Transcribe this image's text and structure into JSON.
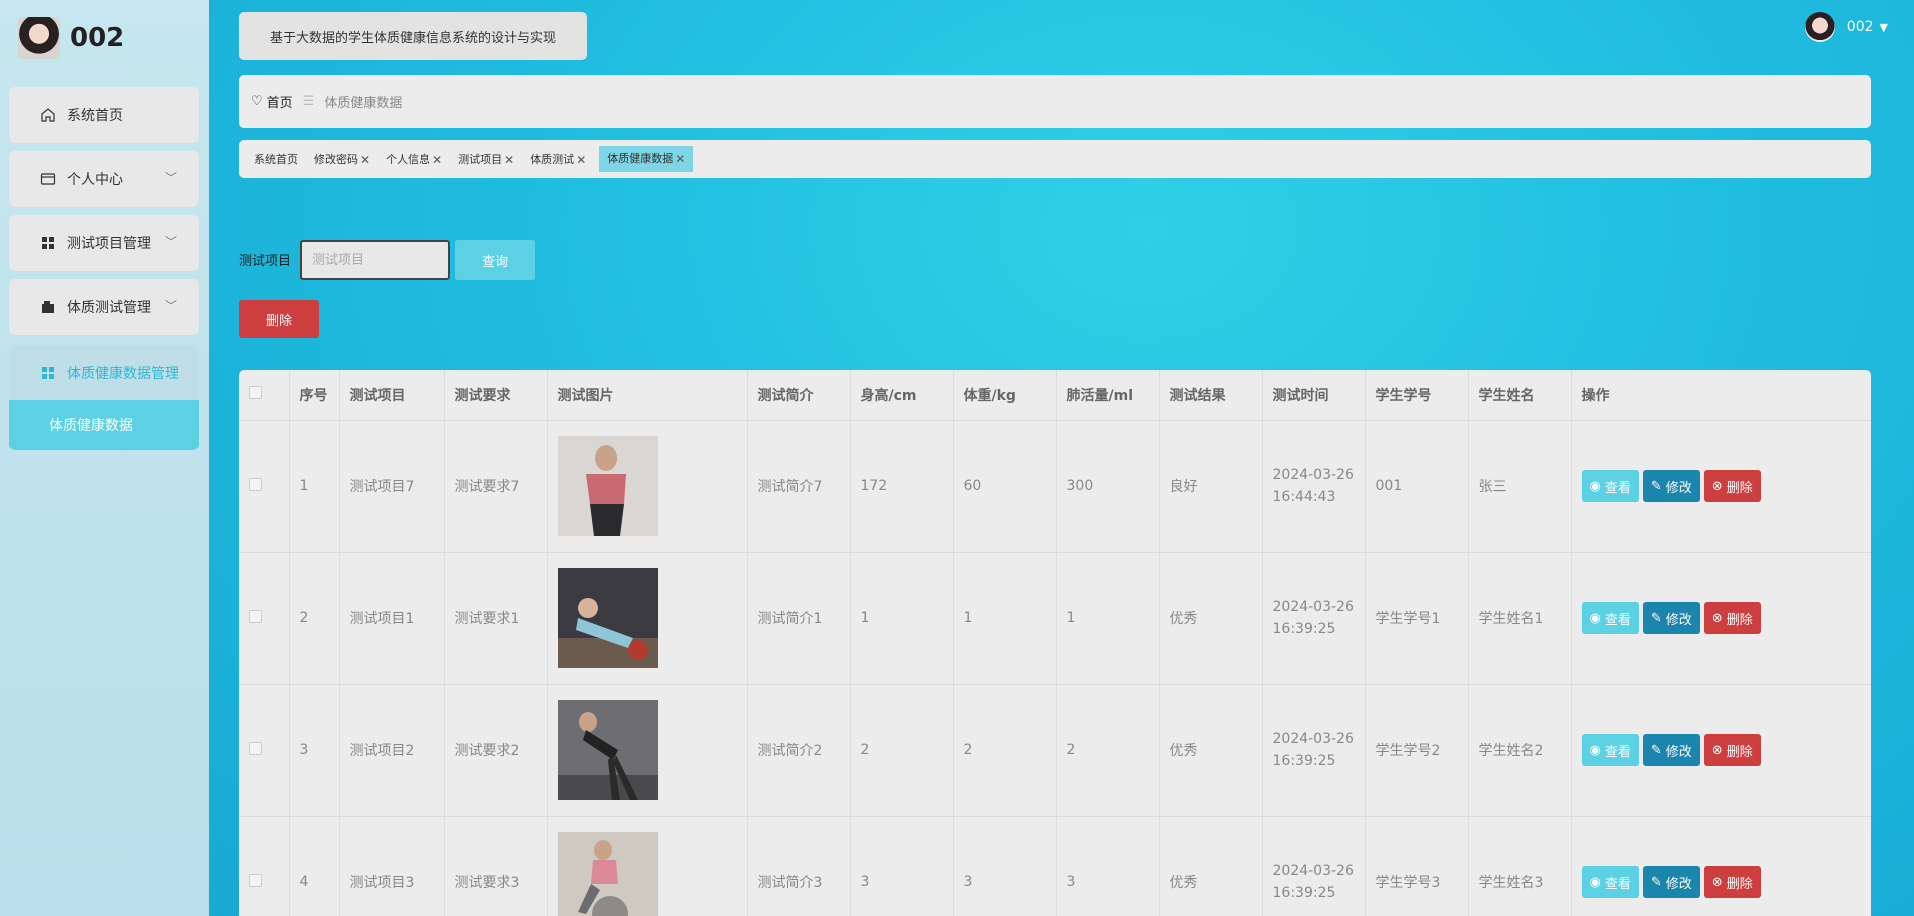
{
  "brand": {
    "name": "002"
  },
  "sidebar": {
    "items": [
      {
        "label": "系统首页"
      },
      {
        "label": "个人中心"
      },
      {
        "label": "测试项目管理"
      },
      {
        "label": "体质测试管理"
      },
      {
        "label": "体质健康数据管理"
      }
    ],
    "submenu": {
      "label": "体质健康数据"
    }
  },
  "header": {
    "title": "基于大数据的学生体质健康信息系统的设计与实现",
    "user": "002"
  },
  "breadcrumb": {
    "home": "首页",
    "separator": "☰",
    "current": "体质健康数据"
  },
  "tags": [
    {
      "label": "系统首页"
    },
    {
      "label": "修改密码"
    },
    {
      "label": "个人信息"
    },
    {
      "label": "测试项目"
    },
    {
      "label": "体质测试"
    },
    {
      "label": "体质健康数据"
    }
  ],
  "search": {
    "label": "测试项目",
    "placeholder": "测试项目",
    "query_label": "查询"
  },
  "actions": {
    "delete_label": "删除"
  },
  "table": {
    "columns": [
      "序号",
      "测试项目",
      "测试要求",
      "测试图片",
      "测试简介",
      "身高/cm",
      "体重/kg",
      "肺活量/ml",
      "测试结果",
      "测试时间",
      "学生学号",
      "学生姓名",
      "操作"
    ],
    "rows": [
      {
        "no": "1",
        "item": "测试项目7",
        "req": "测试要求7",
        "intro": "测试简介7",
        "height": "172",
        "weight": "60",
        "lung": "300",
        "result": "良好",
        "time1": "2024-03-26",
        "time2": "16:44:43",
        "sid": "001",
        "sname": "张三"
      },
      {
        "no": "2",
        "item": "测试项目1",
        "req": "测试要求1",
        "intro": "测试简介1",
        "height": "1",
        "weight": "1",
        "lung": "1",
        "result": "优秀",
        "time1": "2024-03-26",
        "time2": "16:39:25",
        "sid": "学生学号1",
        "sname": "学生姓名1"
      },
      {
        "no": "3",
        "item": "测试项目2",
        "req": "测试要求2",
        "intro": "测试简介2",
        "height": "2",
        "weight": "2",
        "lung": "2",
        "result": "优秀",
        "time1": "2024-03-26",
        "time2": "16:39:25",
        "sid": "学生学号2",
        "sname": "学生姓名2"
      },
      {
        "no": "4",
        "item": "测试项目3",
        "req": "测试要求3",
        "intro": "测试简介3",
        "height": "3",
        "weight": "3",
        "lung": "3",
        "result": "优秀",
        "time1": "2024-03-26",
        "time2": "16:39:25",
        "sid": "学生学号3",
        "sname": "学生姓名3"
      }
    ],
    "ops": {
      "view": "查看",
      "edit": "修改",
      "delete": "删除"
    }
  },
  "colors": {
    "accent": "#5cd1e3",
    "edit": "#1a86ad",
    "danger": "#cd3f3f"
  }
}
